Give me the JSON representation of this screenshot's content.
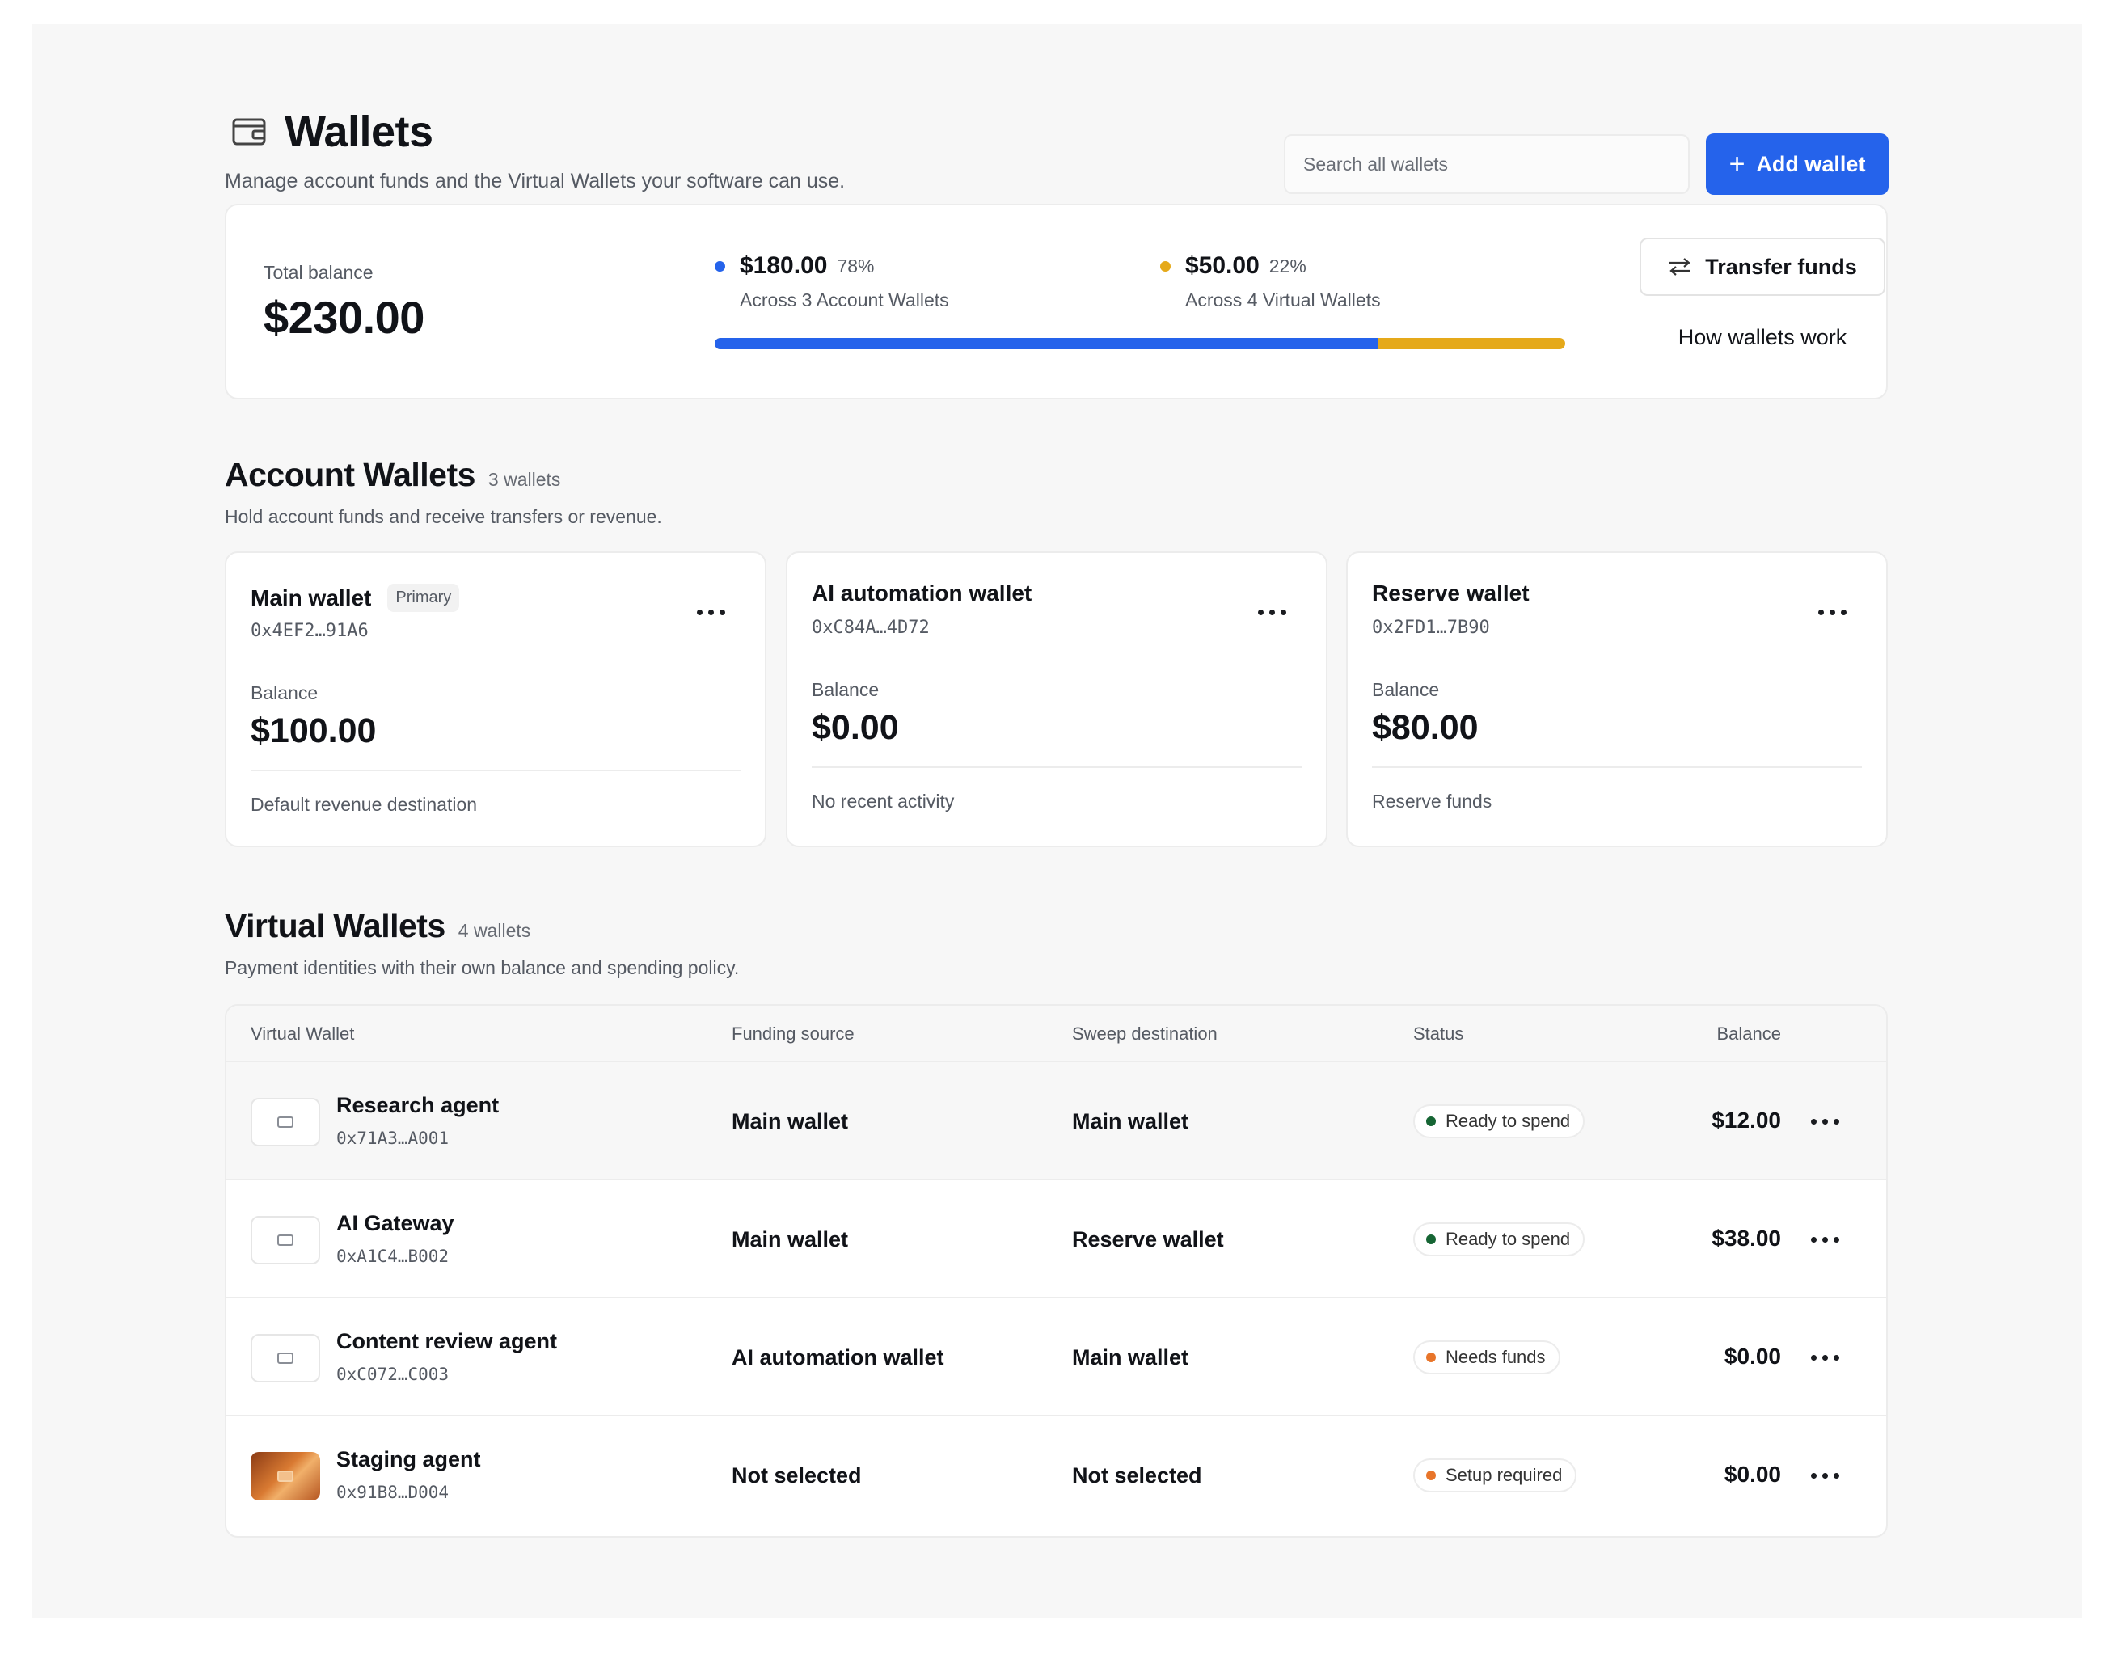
{
  "header": {
    "title": "Wallets",
    "subtitle": "Manage account funds and the Virtual Wallets your software can use.",
    "search_placeholder": "Search all wallets",
    "add_label": "Add wallet"
  },
  "summary": {
    "total_label": "Total balance",
    "total_value": "$230.00",
    "account_amount": "$180.00",
    "account_pct": "78%",
    "account_sub": "Across 3 Account Wallets",
    "virtual_amount": "$50.00",
    "virtual_pct": "22%",
    "virtual_sub": "Across 4 Virtual Wallets",
    "account_fraction": 0.78,
    "transfer_label": "Transfer funds",
    "how_label": "How wallets work"
  },
  "colors": {
    "accent": "#2563eb",
    "virtual": "#e5a91a",
    "ready": "#166534",
    "warning": "#e8752a"
  },
  "account_section": {
    "title": "Account Wallets",
    "count": "3 wallets",
    "description": "Hold account funds and receive transfers or revenue."
  },
  "account_wallets": [
    {
      "name": "Main wallet",
      "badge": "Primary",
      "address": "0x4EF2…91A6",
      "balance_label": "Balance",
      "balance": "$100.00",
      "note": "Default revenue destination"
    },
    {
      "name": "AI automation wallet",
      "address": "0xC84A…4D72",
      "balance_label": "Balance",
      "balance": "$0.00",
      "note": "No recent activity"
    },
    {
      "name": "Reserve wallet",
      "address": "0x2FD1…7B90",
      "balance_label": "Balance",
      "balance": "$80.00",
      "note": "Reserve funds"
    }
  ],
  "virtual_section": {
    "title": "Virtual Wallets",
    "count": "4 wallets",
    "description": "Payment identities with their own balance and spending policy."
  },
  "table": {
    "columns": [
      "Virtual Wallet",
      "Funding source",
      "Sweep destination",
      "Status",
      "Balance"
    ],
    "rows": [
      {
        "name": "Research agent",
        "address": "0x71A3…A001",
        "funding": "Main wallet",
        "sweep": "Main wallet",
        "status": "Ready to spend",
        "balance": "$12.00"
      },
      {
        "name": "AI Gateway",
        "address": "0xA1C4…B002",
        "funding": "Main wallet",
        "sweep": "Reserve wallet",
        "status": "Ready to spend",
        "balance": "$38.00"
      },
      {
        "name": "Content review agent",
        "address": "0xC072…C003",
        "funding": "AI automation wallet",
        "sweep": "Main wallet",
        "status": "Needs funds",
        "balance": "$0.00"
      },
      {
        "name": "Staging agent",
        "address": "0x91B8…D004",
        "funding": "Not selected",
        "sweep": "Not selected",
        "status": "Setup required",
        "balance": "$0.00"
      }
    ]
  }
}
